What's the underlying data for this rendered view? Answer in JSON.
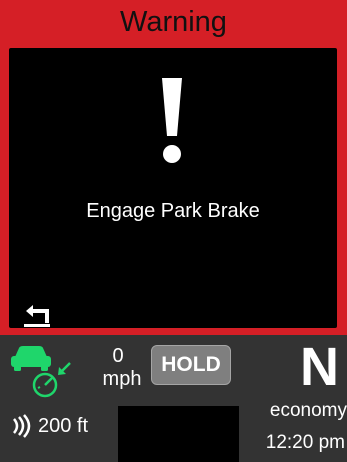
{
  "warning": {
    "title": "Warning",
    "message": "Engage Park Brake",
    "icons": {
      "alert": "exclamation-icon",
      "back": "back-arrow-icon"
    }
  },
  "status": {
    "speed": {
      "value": "0",
      "unit": "mph"
    },
    "hold_label": "HOLD",
    "gear": "N",
    "drive_mode": "economy",
    "time": "12:20 pm",
    "distance": "200 ft",
    "icons": {
      "cruise": "adaptive-cruise-icon",
      "sensor": "proximity-sensor-icon"
    }
  },
  "colors": {
    "warning_red": "#d51f26",
    "panel_black": "#000000",
    "status_gray": "#333333",
    "cruise_green": "#1fd66b",
    "hold_gray": "#7f7f7f"
  }
}
